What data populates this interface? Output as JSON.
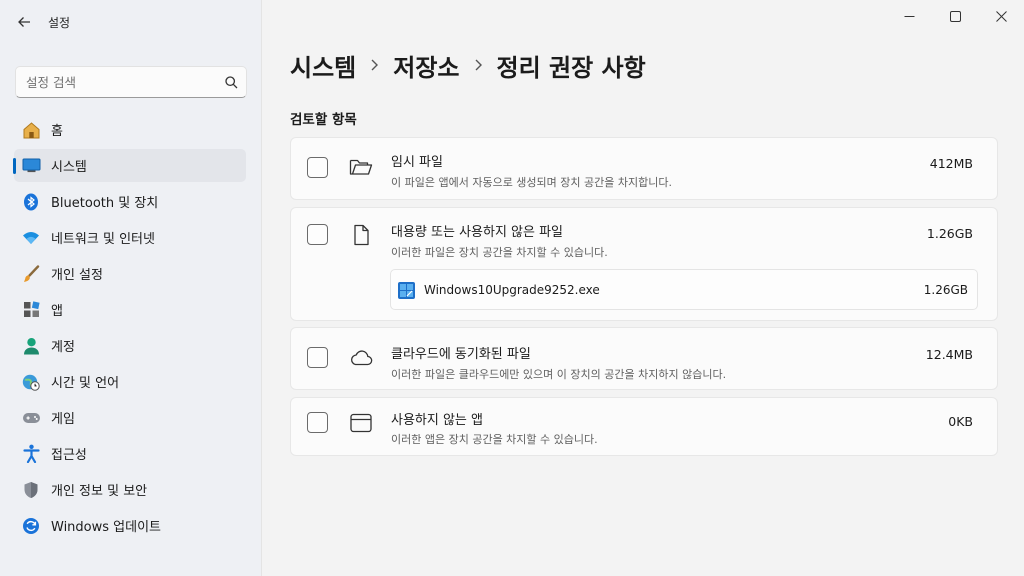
{
  "app": {
    "title": "설정"
  },
  "search": {
    "placeholder": "설정 검색"
  },
  "nav": [
    {
      "label": "홈",
      "icon": "home-icon"
    },
    {
      "label": "시스템",
      "icon": "system-icon",
      "active": true
    },
    {
      "label": "Bluetooth 및 장치",
      "icon": "bluetooth-icon"
    },
    {
      "label": "네트워크 및 인터넷",
      "icon": "wifi-icon"
    },
    {
      "label": "개인 설정",
      "icon": "brush-icon"
    },
    {
      "label": "앱",
      "icon": "apps-icon"
    },
    {
      "label": "계정",
      "icon": "account-icon"
    },
    {
      "label": "시간 및 언어",
      "icon": "globe-clock-icon"
    },
    {
      "label": "게임",
      "icon": "gamepad-icon"
    },
    {
      "label": "접근성",
      "icon": "accessibility-icon"
    },
    {
      "label": "개인 정보 및 보안",
      "icon": "shield-icon"
    },
    {
      "label": "Windows 업데이트",
      "icon": "update-icon"
    }
  ],
  "breadcrumb": [
    "시스템",
    "저장소",
    "정리 권장 사항"
  ],
  "section_title": "검토할 항목",
  "cards": [
    {
      "title": "임시 파일",
      "desc": "이 파일은 앱에서 자동으로 생성되며 장치 공간을 차지합니다.",
      "size": "412MB",
      "icon": "folder-open-icon"
    },
    {
      "title": "대용량 또는 사용하지 않은 파일",
      "desc": "이러한 파일은 장치 공간을 차지할 수 있습니다.",
      "size": "1.26GB",
      "icon": "document-icon",
      "files": [
        {
          "name": "Windows10Upgrade9252.exe",
          "size": "1.26GB"
        }
      ]
    },
    {
      "title": "클라우드에 동기화된 파일",
      "desc": "이러한 파일은 클라우드에만 있으며 이 장치의 공간을 차지하지 않습니다.",
      "size": "12.4MB",
      "icon": "cloud-icon"
    },
    {
      "title": "사용하지 않는 앱",
      "desc": "이러한 앱은 장치 공간을 차지할 수 있습니다.",
      "size": "0KB",
      "icon": "app-window-icon"
    }
  ],
  "colors": {
    "accent": "#0067c0",
    "background": "#f3f3f3",
    "sidebar": "#eef0f4",
    "card": "#fbfbfb"
  }
}
